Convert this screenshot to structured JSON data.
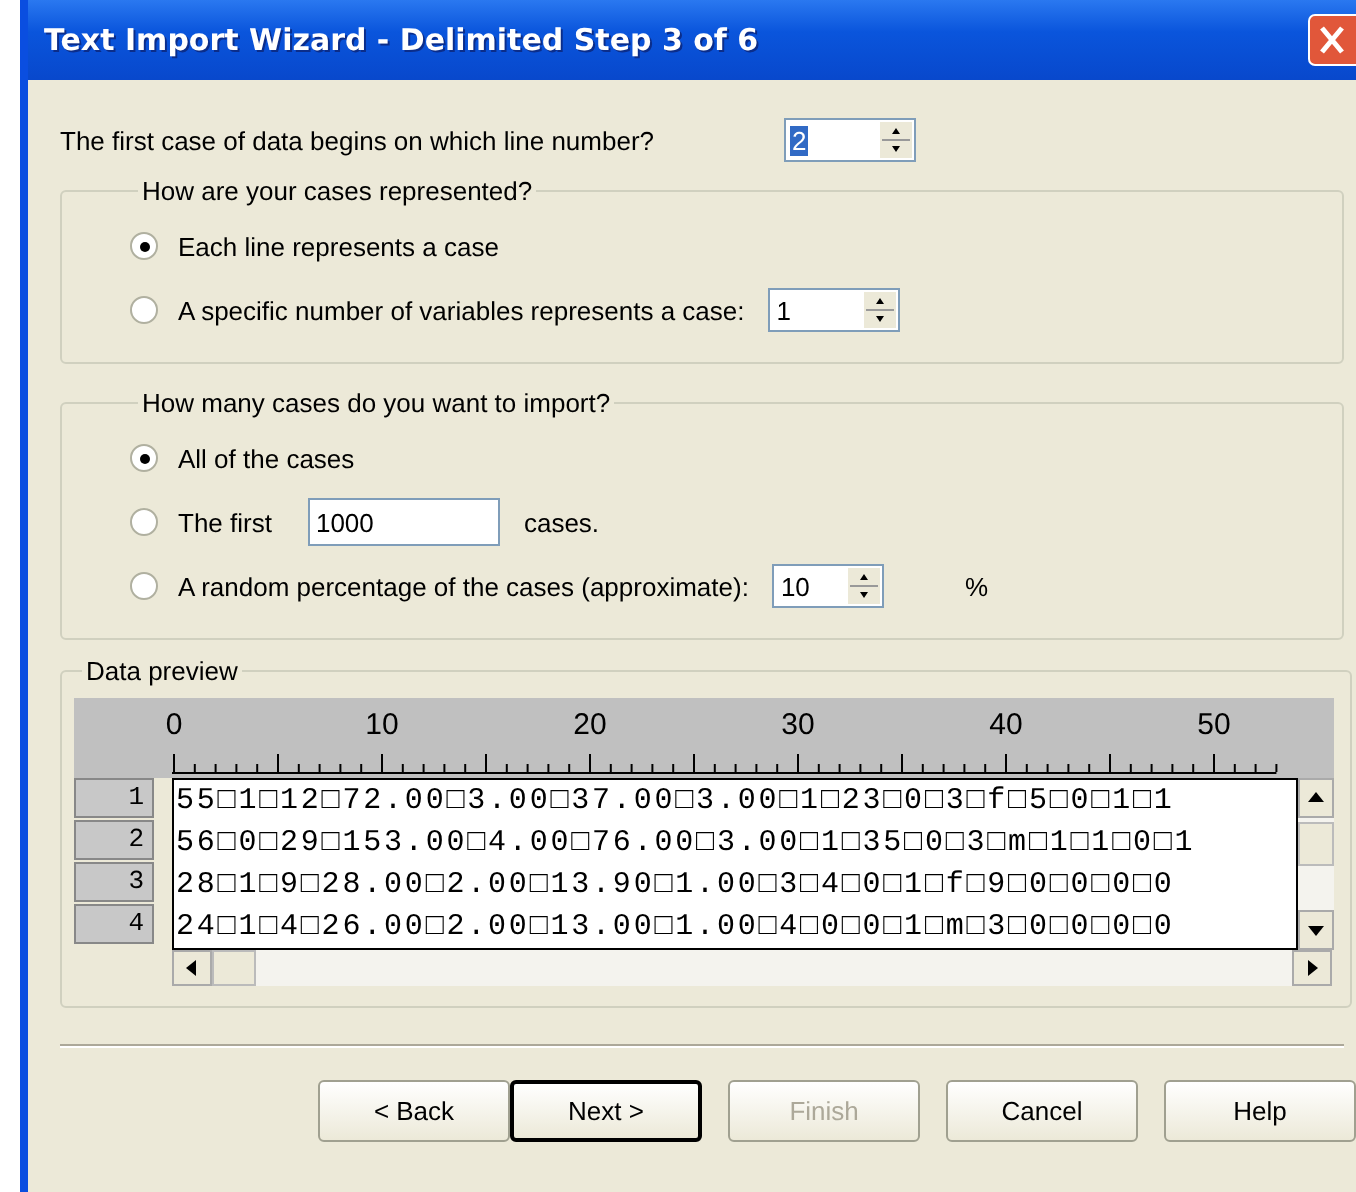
{
  "window": {
    "title": "Text Import Wizard - Delimited Step 3 of 6"
  },
  "start_line": {
    "label": "The first case of data begins on which line number?",
    "value": "2"
  },
  "represent_group": {
    "title": "How are your cases represented?",
    "options": [
      {
        "kind": "plain",
        "label": "Each line represents a case",
        "selected": true
      },
      {
        "kind": "spin",
        "label": "A specific number of variables represents a case:",
        "value": "1",
        "selected": false
      }
    ]
  },
  "import_group": {
    "title": "How many cases do you want to import?",
    "options": [
      {
        "kind": "plain",
        "label": "All of the cases",
        "selected": true
      },
      {
        "kind": "text",
        "label": "The first",
        "value": "1000",
        "suffix": "cases.",
        "selected": false
      },
      {
        "kind": "spin",
        "label": "A random percentage of the cases (approximate):",
        "value": "10",
        "suffix": "%",
        "selected": false
      }
    ]
  },
  "preview": {
    "title": "Data preview",
    "ruler": [
      "0",
      "10",
      "20",
      "30",
      "40",
      "50"
    ],
    "rows": [
      {
        "number": "1",
        "text": "55□1□12□72.00□3.00□37.00□3.00□1□23□0□3□f□5□0□1□1"
      },
      {
        "number": "2",
        "text": "56□0□29□153.00□4.00□76.00□3.00□1□35□0□3□m□1□1□0□1"
      },
      {
        "number": "3",
        "text": "28□1□9□28.00□2.00□13.90□1.00□3□4□0□1□f□9□0□0□0□0"
      },
      {
        "number": "4",
        "text": "24□1□4□26.00□2.00□13.00□1.00□4□0□0□1□m□3□0□0□0□0"
      }
    ]
  },
  "buttons": [
    {
      "label": "< Back",
      "disabled": false,
      "default": false
    },
    {
      "label": "Next >",
      "disabled": false,
      "default": true
    },
    {
      "label": "Finish",
      "disabled": true,
      "default": false
    },
    {
      "label": "Cancel",
      "disabled": false,
      "default": false
    },
    {
      "label": "Help",
      "disabled": false,
      "default": false
    }
  ]
}
